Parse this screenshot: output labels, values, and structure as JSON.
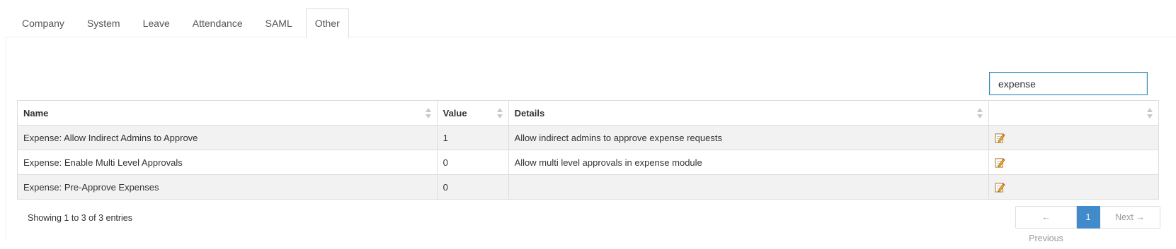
{
  "tabs": [
    {
      "label": "Company"
    },
    {
      "label": "System"
    },
    {
      "label": "Leave"
    },
    {
      "label": "Attendance"
    },
    {
      "label": "SAML"
    },
    {
      "label": "Other",
      "active": true
    }
  ],
  "search": {
    "value": "expense"
  },
  "table": {
    "headers": [
      "Name",
      "Value",
      "Details",
      ""
    ],
    "rows": [
      {
        "name": "Expense: Allow Indirect Admins to Approve",
        "value": "1",
        "details": "Allow indirect admins to approve expense requests",
        "action_icon": "edit-icon"
      },
      {
        "name": "Expense: Enable Multi Level Approvals",
        "value": "0",
        "details": "Allow multi level approvals in expense module",
        "action_icon": "edit-icon"
      },
      {
        "name": "Expense: Pre-Approve Expenses",
        "value": "0",
        "details": "",
        "action_icon": "edit-icon"
      }
    ]
  },
  "footer": {
    "info": "Showing 1 to 3 of 3 entries",
    "pagination": {
      "previous": "← Previous",
      "current": "1",
      "next": "Next →"
    }
  },
  "colors": {
    "accent": "#428bca",
    "row_stripe": "#f2f2f3",
    "border": "#dddddd"
  }
}
